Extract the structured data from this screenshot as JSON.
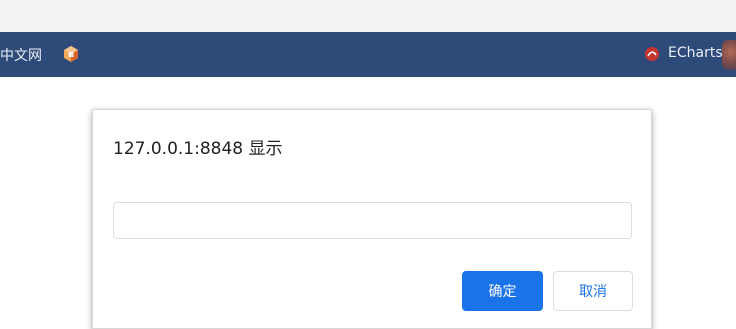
{
  "bookmarks_bar": {
    "left_item_label": "中文网",
    "right_item_label": "ECharts"
  },
  "dialog": {
    "title": "127.0.0.1:8848 显示",
    "input_value": "",
    "ok_label": "确定",
    "cancel_label": "取消"
  },
  "colors": {
    "bookmarks_bar_bg": "#2e4a78",
    "primary_button": "#1a73e8"
  },
  "icons": {
    "left_bookmark_icon": "cube-logo-icon",
    "right_bookmark_icon": "echarts-logo-icon"
  }
}
